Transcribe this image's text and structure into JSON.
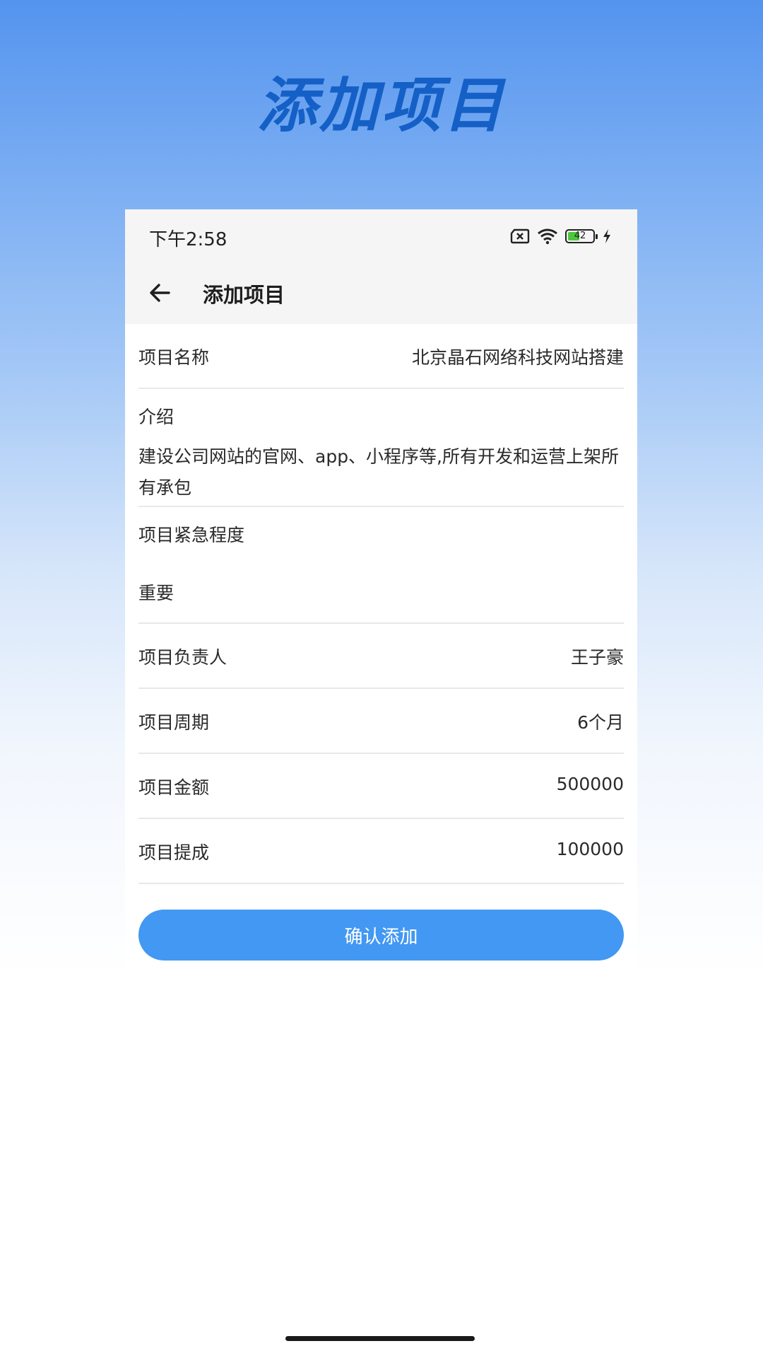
{
  "hero_title": "添加项目",
  "status_bar": {
    "time": "下午2:58",
    "battery": "42"
  },
  "app_bar": {
    "title": "添加项目"
  },
  "form": {
    "project_name": {
      "label": "项目名称",
      "value": "北京晶石网络科技网站搭建"
    },
    "intro": {
      "label": "介绍",
      "value": "建设公司网站的官网、app、小程序等,所有开发和运营上架所有承包"
    },
    "urgency": {
      "label": "项目紧急程度",
      "value": "重要"
    },
    "owner": {
      "label": "项目负责人",
      "value": "王子豪"
    },
    "period": {
      "label": "项目周期",
      "value": "6个月"
    },
    "amount": {
      "label": "项目金额",
      "value": "500000"
    },
    "commission": {
      "label": "项目提成",
      "value": "100000"
    }
  },
  "confirm_button": "确认添加",
  "colors": {
    "accent": "#4298f3",
    "hero": "#1560c6"
  },
  "icons": [
    "sim-missing-icon",
    "wifi-icon",
    "battery-icon",
    "charging-icon",
    "back-arrow-icon"
  ]
}
